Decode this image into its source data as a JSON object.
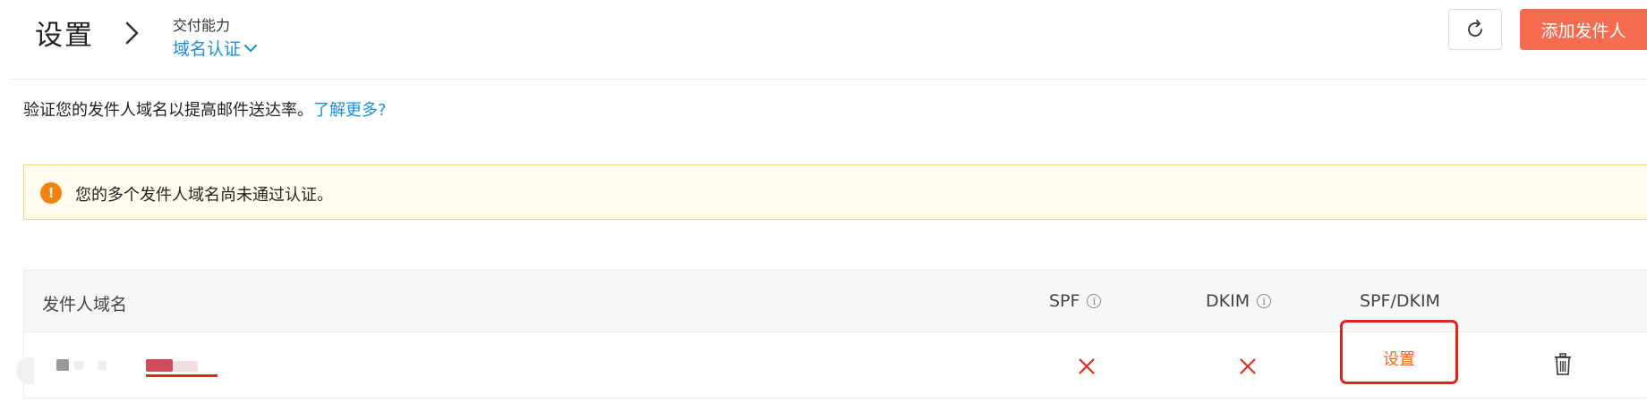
{
  "header": {
    "title": "设置",
    "breadcrumb_section": "交付能力",
    "breadcrumb_current": "域名认证",
    "add_button_label": "添加发件人"
  },
  "description": {
    "text": "验证您的发件人域名以提高邮件送达率。",
    "link_text": "了解更多?"
  },
  "alert": {
    "text": "您的多个发件人域名尚未通过认证。",
    "icon": "exclamation-icon"
  },
  "table": {
    "columns": [
      "发件人域名",
      "SPF",
      "DKIM",
      "SPF/DKIM"
    ],
    "rows": [
      {
        "domain": "",
        "spf": "fail",
        "dkim": "fail",
        "action_label": "设置"
      }
    ]
  },
  "colors": {
    "accent_blue": "#1a8fdc",
    "primary_button": "#f76b50",
    "error_red": "#e2231a",
    "action_orange": "#f26a1b",
    "alert_bg": "#fffcef",
    "alert_border": "#f4d57d"
  }
}
